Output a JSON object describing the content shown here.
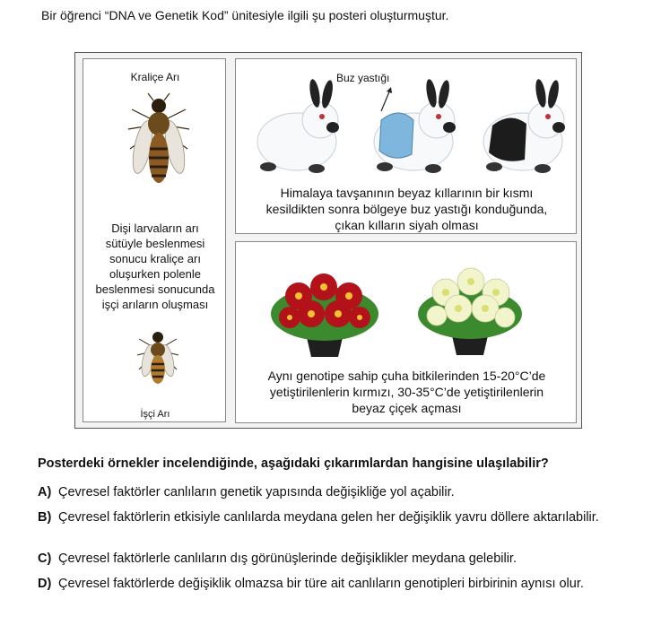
{
  "intro": "Bir öğrenci “DNA ve Genetik Kod” ünitesiyle ilgili şu posteri oluşturmuştur.",
  "poster": {
    "left": {
      "queen_label": "Kraliçe Arı",
      "description_lines": [
        "Dişi larvaların arı",
        "sütüyle beslenmesi",
        "sonucu kraliçe arı",
        "oluşurken polenle",
        "beslenmesi sonucunda",
        "işçi arıların oluşması"
      ],
      "worker_label": "İşçi Arı"
    },
    "top": {
      "ice_label": "Buz yastığı",
      "description_lines": [
        "Himalaya tavşanının beyaz kıllarının bir kısmı",
        "kesildikten sonra bölgeye buz yastığı konduğunda,",
        "çıkan kılların siyah olması"
      ]
    },
    "bottom": {
      "description_lines": [
        "Aynı genotipe sahip çuha bitkilerinden 15-20°C’de",
        "yetiştirilenlerin kırmızı, 30-35°C’de yetiştirilenlerin",
        "beyaz çiçek açması"
      ]
    }
  },
  "question": "Posterdeki örnekler incelendiğinde, aşağıdaki çıkarımlardan hangisine ulaşılabilir?",
  "options": [
    {
      "key": "A)",
      "text": "Çevresel faktörler canlıların genetik yapısında değişikliğe yol açabilir."
    },
    {
      "key": "B)",
      "text": "Çevresel faktörlerin etkisiyle canlılarda meydana gelen her değişiklik yavru döllere aktarılabilir."
    },
    {
      "key": "C)",
      "text": "Çevresel faktörlerle canlıların dış görünüşlerinde değişiklikler meydana gelebilir."
    },
    {
      "key": "D)",
      "text": "Çevresel faktörlerde değişiklik olmazsa bir türe ait canlıların genotipleri birbirinin aynısı olur."
    }
  ],
  "colors": {
    "red_flower": "#b3121a",
    "white_flower": "#f2f4cc",
    "leaf": "#3c8a2e",
    "ice_pack": "#7fb6dd"
  }
}
